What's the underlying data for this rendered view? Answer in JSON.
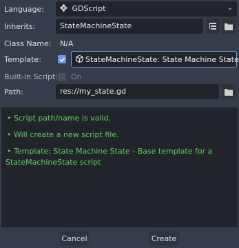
{
  "form": {
    "language": {
      "label": "Language:",
      "value": "GDScript"
    },
    "inherits": {
      "label": "Inherits:",
      "value": "StateMachineState"
    },
    "class_name": {
      "label": "Class Name:",
      "value": "N/A"
    },
    "template": {
      "label": "Template:",
      "value": "StateMachineState: State Machine State",
      "checked": true
    },
    "builtin": {
      "label": "Built-in Script:",
      "toggle_label": "On",
      "checked": false
    },
    "path": {
      "label": "Path:",
      "value": "res://my_state.gd"
    }
  },
  "status_lines": [
    "• Script path/name is valid.",
    "• Will create a new script file.",
    "• Template: State Machine State - Base template for a",
    "StateMachineState script"
  ],
  "buttons": {
    "cancel": "Cancel",
    "create": "Create"
  },
  "colors": {
    "accent": "#699ce8",
    "success": "#5ad05a",
    "panel": "#21252b",
    "background": "#363d4a"
  }
}
